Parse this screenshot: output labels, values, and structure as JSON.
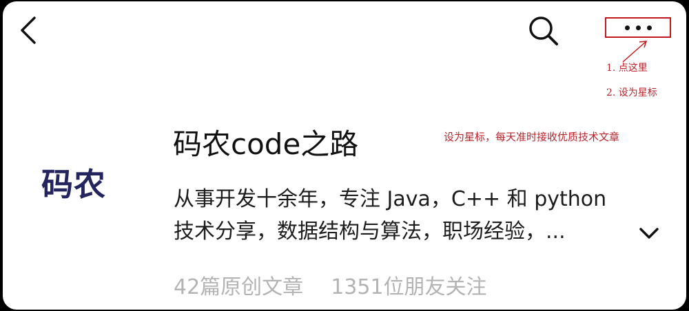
{
  "header": {
    "back_icon": "chevron-left-icon",
    "search_icon": "search-icon",
    "more_icon": "more-horizontal-icon"
  },
  "annotations": {
    "step1": "1. 点这里",
    "step2": "2. 设为星标",
    "tip": "设为星标，每天准时接收优质技术文章",
    "color": "#b8232a"
  },
  "account": {
    "logo_text": "码农",
    "name": "码农code之路",
    "description_line1": "从事开发十余年，专注 Java，C++ 和 python",
    "description_line2": "技术分享，数据结构与算法，职场经验，...",
    "expand_icon": "chevron-down-icon",
    "articles": "42篇原创文章",
    "followers": "1351位朋友关注"
  }
}
